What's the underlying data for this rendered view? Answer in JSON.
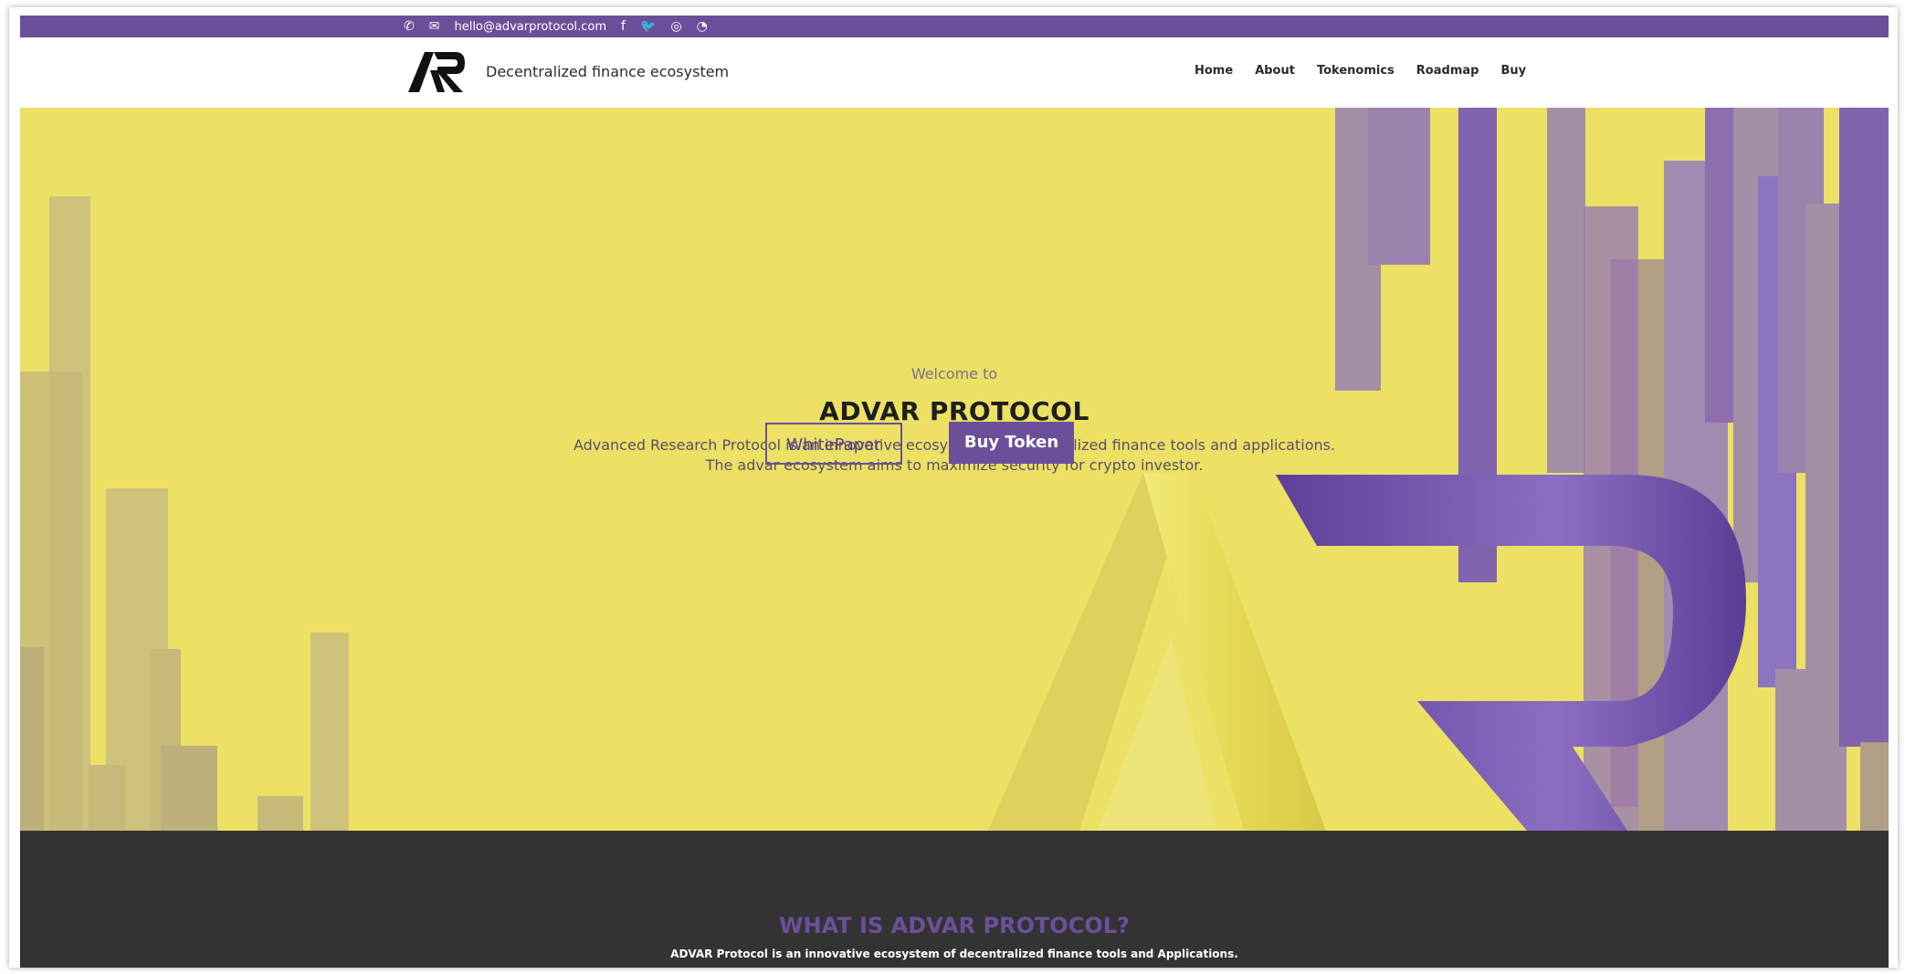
{
  "contact": {
    "email": "hello@advarprotocol.com"
  },
  "header": {
    "tagline": "Decentralized finance ecosystem",
    "nav": [
      "Home",
      "About",
      "Tokenomics",
      "Roadmap",
      "Buy"
    ]
  },
  "hero": {
    "welcome": "Welcome to",
    "title": "ADVAR PROTOCOL",
    "desc_line1": "Advanced Research Protocol is an innovative ecosystem of decentralized finance tools and applications.",
    "desc_line2": "The advar ecosystem aims to maximize security for crypto investor.",
    "whitepaper_label": "WhitePaper",
    "buy_label": "Buy Token"
  },
  "about": {
    "title": "WHAT IS ADVAR PROTOCOL?",
    "desc": "ADVAR Protocol is an innovative ecosystem of decentralized finance tools and Applications."
  },
  "colors": {
    "brand_purple": "#6b4f9b",
    "hero_yellow": "#ece164",
    "dark_section": "#333333"
  },
  "icons": [
    "phone-icon",
    "mail-icon",
    "facebook-icon",
    "twitter-icon",
    "instagram-icon",
    "rss-icon",
    "ar-logo-icon"
  ]
}
